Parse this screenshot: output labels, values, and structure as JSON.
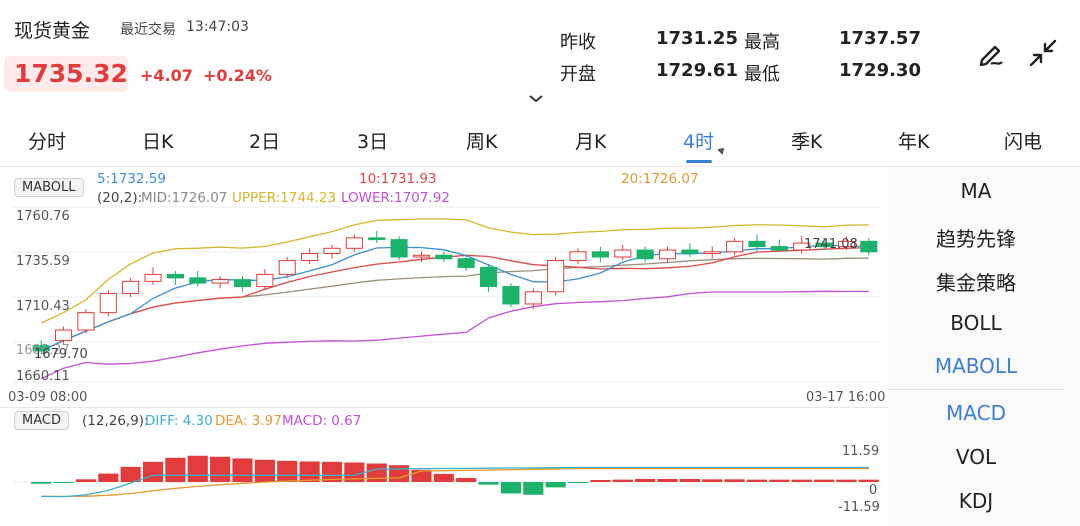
{
  "header": {
    "instrument": "现货黄金",
    "last_trade_label": "最近交易",
    "last_trade_time": "13:47:03",
    "price": "1735.32",
    "change": "+4.07",
    "change_pct": "+0.24%",
    "stats": [
      {
        "label": "昨收",
        "value": "1731.25"
      },
      {
        "label": "最高",
        "value": "1737.57"
      },
      {
        "label": "开盘",
        "value": "1729.61"
      },
      {
        "label": "最低",
        "value": "1729.30"
      }
    ],
    "up_color": "#e23b3b"
  },
  "tabs": [
    "分时",
    "日K",
    "2日",
    "3日",
    "周K",
    "月K",
    "4时",
    "季K",
    "年K",
    "闪电"
  ],
  "active_tab": "4时",
  "main_chart": {
    "indicator": "MABOLL",
    "ma5": "5:1732.59",
    "ma10": "10:1731.93",
    "ma20": "20:1726.07",
    "boll_params": "(20,2):",
    "mid": "MID:1726.07",
    "upper": "UPPER:1744.23",
    "lower": "LOWER:1707.92",
    "y_labels": [
      "1760.76",
      "1735.59",
      "1710.43",
      "1660.11"
    ],
    "extra_left_label": "1685.27",
    "low_mark": "1679.70",
    "high_mark": "1741.08",
    "x_start": "03-09 08:00",
    "x_end": "03-17 16:00",
    "colors": {
      "ma5": "#3b8ed8",
      "ma10": "#e04848",
      "ma20": "#e39a2e",
      "upper": "#d6b62c",
      "lower": "#c44fd8",
      "mid": "#9a8f7a"
    }
  },
  "macd": {
    "indicator": "MACD",
    "params": "(12,26,9):",
    "diff": "DIFF: 4.30",
    "dea": "DEA: 3.97",
    "macd": "MACD: 0.67",
    "y_top": "11.59",
    "y_zero": "0",
    "y_bottom": "-11.59"
  },
  "side_menu": [
    {
      "label": "MA",
      "active": false
    },
    {
      "label": "趋势先锋",
      "active": false
    },
    {
      "label": "集金策略",
      "active": false
    },
    {
      "label": "BOLL",
      "active": false
    },
    {
      "label": "MABOLL",
      "active": true
    },
    {
      "label": "MACD",
      "active": true
    },
    {
      "label": "VOL",
      "active": false
    },
    {
      "label": "KDJ",
      "active": false
    }
  ],
  "chart_data": {
    "type": "candlestick",
    "candles": [
      [
        1681,
        1678,
        1684,
        1676
      ],
      [
        1684,
        1690,
        1692,
        1682
      ],
      [
        1690,
        1700,
        1702,
        1688
      ],
      [
        1700,
        1711,
        1713,
        1698
      ],
      [
        1711,
        1718,
        1720,
        1709
      ],
      [
        1718,
        1722,
        1726,
        1716
      ],
      [
        1722,
        1720,
        1724,
        1716
      ],
      [
        1720,
        1717,
        1724,
        1715
      ],
      [
        1717,
        1719,
        1721,
        1714
      ],
      [
        1719,
        1715,
        1721,
        1712
      ],
      [
        1715,
        1722,
        1725,
        1713
      ],
      [
        1722,
        1730,
        1732,
        1720
      ],
      [
        1730,
        1734,
        1737,
        1728
      ],
      [
        1734,
        1737,
        1739,
        1731
      ],
      [
        1737,
        1743,
        1745,
        1735
      ],
      [
        1743,
        1742,
        1747,
        1740
      ],
      [
        1742,
        1732,
        1744,
        1730
      ],
      [
        1732,
        1733,
        1735,
        1729
      ],
      [
        1733,
        1731,
        1735,
        1729
      ],
      [
        1731,
        1726,
        1733,
        1724
      ],
      [
        1726,
        1715,
        1728,
        1712
      ],
      [
        1715,
        1705,
        1717,
        1703
      ],
      [
        1705,
        1712,
        1714,
        1702
      ],
      [
        1712,
        1730,
        1732,
        1710
      ],
      [
        1730,
        1735,
        1737,
        1728
      ],
      [
        1735,
        1732,
        1738,
        1729
      ],
      [
        1732,
        1736,
        1739,
        1730
      ],
      [
        1736,
        1731,
        1738,
        1729
      ],
      [
        1731,
        1736,
        1738,
        1729
      ],
      [
        1736,
        1734,
        1740,
        1732
      ],
      [
        1734,
        1735,
        1738,
        1731
      ],
      [
        1735,
        1741,
        1743,
        1733
      ],
      [
        1741,
        1738,
        1745,
        1735
      ],
      [
        1738,
        1736,
        1742,
        1735
      ],
      [
        1736,
        1740,
        1744,
        1734
      ],
      [
        1740,
        1738,
        1743,
        1736
      ],
      [
        1738,
        1741,
        1744,
        1736
      ],
      [
        1741,
        1735,
        1743,
        1733
      ]
    ],
    "macd_bars": [
      -0.5,
      -0.2,
      0.8,
      2.5,
      4.5,
      6,
      7.2,
      7.8,
      7.5,
      7.0,
      6.6,
      6.3,
      6.1,
      6.0,
      5.8,
      5.5,
      5.0,
      3.6,
      2.4,
      1.2,
      -0.8,
      -3.4,
      -3.8,
      -1.6,
      -0.3,
      0.6,
      0.7,
      0.9,
      0.9,
      0.9,
      0.8,
      0.8,
      0.7,
      0.7,
      0.7,
      0.7,
      0.7,
      0.7
    ],
    "ylim_main": [
      1660.11,
      1760.76
    ],
    "ylim_macd": [
      -11.59,
      11.59
    ]
  }
}
